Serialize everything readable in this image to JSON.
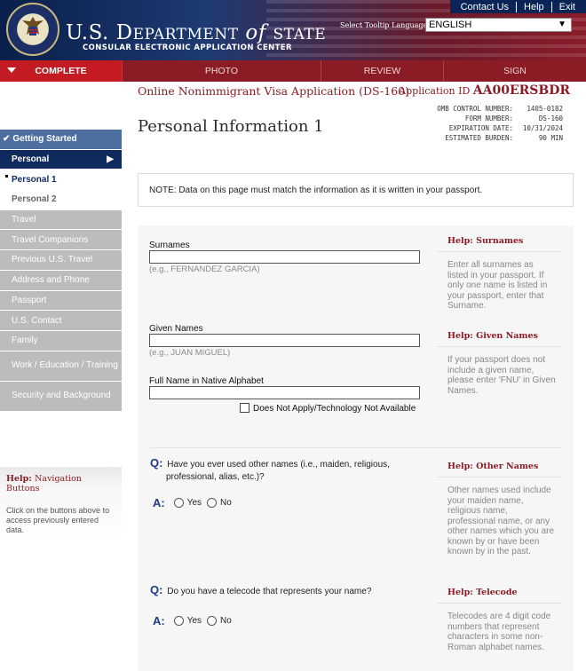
{
  "header": {
    "title_prefix": "U.S. D",
    "title_main": "EPARTMENT",
    "title_of": "of",
    "title_state": "STATE",
    "subtitle": "CONSULAR ELECTRONIC APPLICATION CENTER",
    "links": [
      "Contact Us",
      "Help",
      "Exit"
    ],
    "lang_label": "Select Tooltip Language",
    "lang_value": "ENGLISH"
  },
  "tabs": [
    {
      "label": "COMPLETE",
      "active": true
    },
    {
      "label": "PHOTO",
      "active": false
    },
    {
      "label": "REVIEW",
      "active": false
    },
    {
      "label": "SIGN",
      "active": false
    }
  ],
  "app": {
    "title": "Online Nonimmigrant Visa Application (DS-160)",
    "id_label": "Application ID",
    "id_value": "AA00ERSBDR",
    "omb": [
      {
        "label": "OMB CONTROL NUMBER:",
        "value": "1405-0182"
      },
      {
        "label": "FORM NUMBER:",
        "value": "DS-160"
      },
      {
        "label": "EXPIRATION DATE:",
        "value": "10/31/2024"
      },
      {
        "label": "ESTIMATED BURDEN:",
        "value": "90 MIN"
      }
    ],
    "page_title": "Personal Information 1"
  },
  "nav": {
    "items": [
      {
        "label": "Getting Started",
        "state": "done"
      },
      {
        "label": "Personal",
        "state": "current"
      },
      {
        "label": "Personal 1",
        "state": "sub-active"
      },
      {
        "label": "Personal 2",
        "state": "sub"
      },
      {
        "label": "Travel",
        "state": "pending"
      },
      {
        "label": "Travel Companions",
        "state": "pending"
      },
      {
        "label": "Previous U.S. Travel",
        "state": "pending"
      },
      {
        "label": "Address and Phone",
        "state": "pending"
      },
      {
        "label": "Passport",
        "state": "pending"
      },
      {
        "label": "U.S. Contact",
        "state": "pending"
      },
      {
        "label": "Family",
        "state": "pending"
      },
      {
        "label": "Work / Education / Training",
        "state": "pending"
      },
      {
        "label": "Security and Background",
        "state": "pending"
      }
    ],
    "help_prefix": "Help:",
    "help_title": "Navigation Buttons",
    "help_text": "Click on the buttons above to access previously entered data."
  },
  "note": "NOTE: Data on this page must match the information as it is written in your passport.",
  "form": {
    "surnames_label": "Surnames",
    "surnames_hint": "(e.g., FERNANDEZ GARCIA)",
    "given_label": "Given Names",
    "given_hint": "(e.g., JUAN MIGUEL)",
    "native_label": "Full Name in Native Alphabet",
    "native_na": "Does Not Apply/Technology Not Available",
    "q_prefix": "Q:",
    "a_prefix": "A:",
    "yes": "Yes",
    "no": "No",
    "q1": "Have you ever used other names (i.e., maiden, religious, professional, alias, etc.)?",
    "q2": "Do you have a telecode that represents your name?"
  },
  "help": {
    "prefix": "Help:",
    "surnames_title": "Surnames",
    "surnames_text": "Enter all surnames as listed in your passport. If only one name is listed in your passport, enter that Surname.",
    "given_title": "Given Names",
    "given_text": "If your passport does not include a given name, please enter 'FNU' in Given Names.",
    "other_title": "Other Names",
    "other_text": "Other names used include your maiden name, religious name, professional name, or any other names which you are known by or have been known by in the past.",
    "telecode_title": "Telecode",
    "telecode_text": "Telecodes are 4 digit code numbers that represent characters in some non-Roman alphabet names."
  }
}
